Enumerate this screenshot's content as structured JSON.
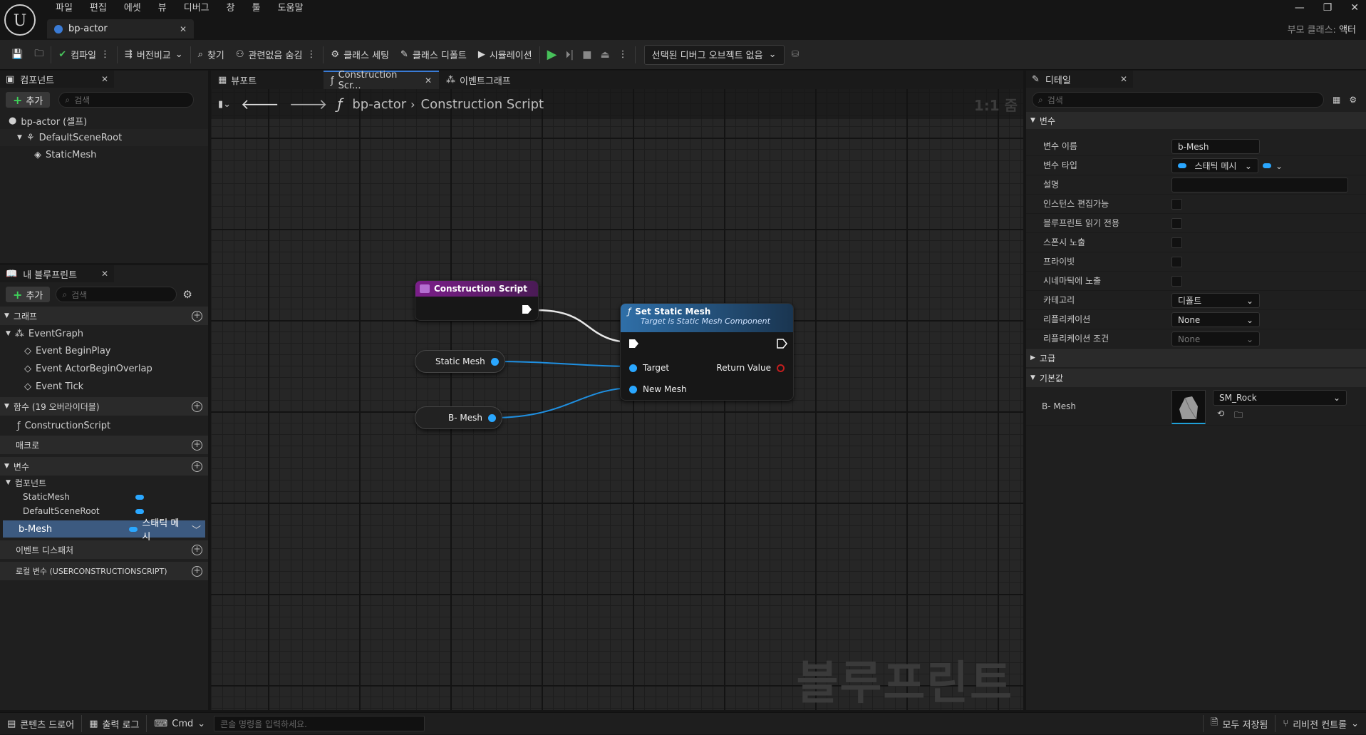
{
  "menu": [
    "파일",
    "편집",
    "에셋",
    "뷰",
    "디버그",
    "창",
    "툴",
    "도움말"
  ],
  "doc_tab": "bp-actor",
  "parent_class": {
    "label": "부모 클래스:",
    "value": "액터"
  },
  "toolbar": {
    "compile": "컴파일",
    "diff": "버전비교",
    "find": "찾기",
    "hide": "관련없음 숨김",
    "class_settings": "클래스 세팅",
    "class_defaults": "클래스 디폴트",
    "simulation": "시뮬레이션",
    "debug_object": "선택된 디버그 오브젝트 없음"
  },
  "components": {
    "title": "컴포넌트",
    "add": "추가",
    "search_placeholder": "검색",
    "items": [
      "bp-actor (셀프)",
      "DefaultSceneRoot",
      "StaticMesh"
    ]
  },
  "my_blueprint": {
    "title": "내 블루프린트",
    "add": "추가",
    "search_placeholder": "검색",
    "graphs": "그래프",
    "event_graph": "EventGraph",
    "events": [
      "Event BeginPlay",
      "Event ActorBeginOverlap",
      "Event Tick"
    ],
    "functions": "함수 (19 오버라이더블)",
    "function_items": [
      "ConstructionScript"
    ],
    "macros": "매크로",
    "variables": "변수",
    "components_cat": "컴포넌트",
    "var_items": [
      "StaticMesh",
      "DefaultSceneRoot"
    ],
    "selected_var": "b-Mesh",
    "selected_var_type": "스태틱 메시",
    "dispatchers": "이벤트 디스패처",
    "local_vars": "로컬 변수 (USERCONSTRUCTIONSCRIPT)"
  },
  "graph_tabs": [
    "뷰포트",
    "Construction Scr...",
    "이벤트그래프"
  ],
  "breadcrumb": {
    "root": "bp-actor",
    "current": "Construction Script",
    "zoom": "1:1 줌"
  },
  "nodes": {
    "construction": "Construction Script",
    "set_mesh": "Set Static Mesh",
    "set_mesh_sub": "Target is Static Mesh Component",
    "target": "Target",
    "return_value": "Return Value",
    "new_mesh": "New Mesh",
    "var1": "Static Mesh",
    "var2": "B- Mesh"
  },
  "watermark": "블루프린트",
  "details": {
    "title": "디테일",
    "search_placeholder": "검색",
    "section_vars": "변수",
    "rows": {
      "name_label": "변수 이름",
      "name_value": "b-Mesh",
      "type_label": "변수 타입",
      "type_value": "스태틱 메시",
      "desc_label": "설명",
      "instance_label": "인스턴스 편집가능",
      "readonly_label": "블루프린트 읽기 전용",
      "spawn_label": "스폰시 노출",
      "private_label": "프라이빗",
      "cinematic_label": "시네마틱에 노출",
      "category_label": "카테고리",
      "category_value": "디폴트",
      "rep_label": "리플리케이션",
      "rep_value": "None",
      "repcond_label": "리플리케이션 조건",
      "repcond_value": "None"
    },
    "section_adv": "고급",
    "section_default": "기본값",
    "default_label": "B- Mesh",
    "default_asset": "SM_Rock"
  },
  "status": {
    "content_drawer": "콘텐츠 드로어",
    "output_log": "출력 로그",
    "cmd": "Cmd",
    "console_placeholder": "콘솔 명령을 입력하세요.",
    "save_all": "모두 저장됨",
    "revision": "리비전 컨트롤"
  }
}
